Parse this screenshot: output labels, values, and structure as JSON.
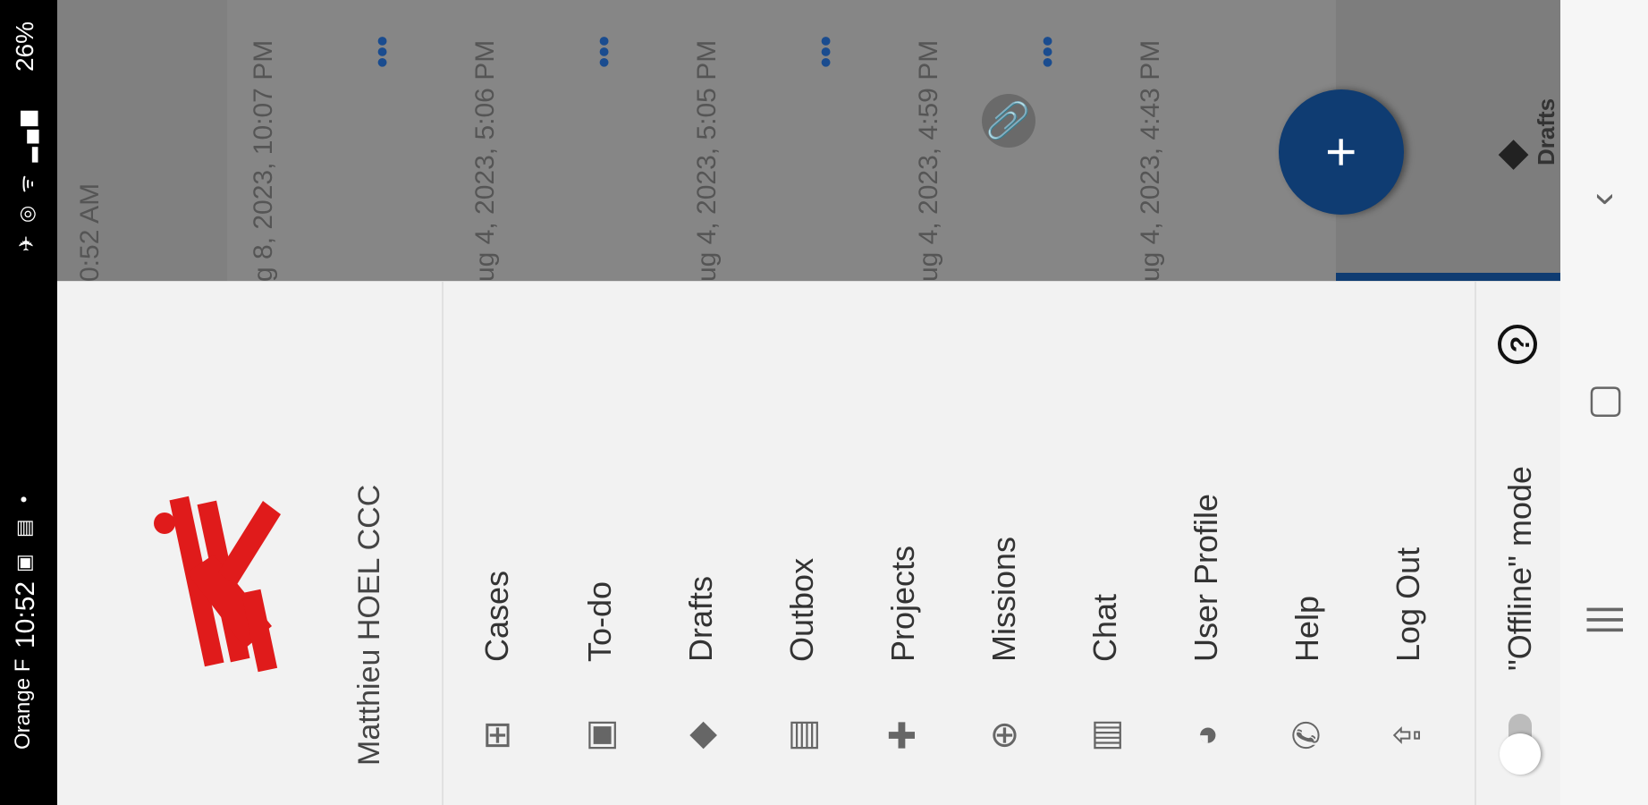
{
  "status_bar": {
    "carrier": "Orange F",
    "time": "10:52",
    "battery": "26%"
  },
  "drawer": {
    "user_name": "Matthieu HOEL CCC",
    "menu": [
      {
        "label": "Cases",
        "icon": "medical-case-icon"
      },
      {
        "label": "To-do",
        "icon": "todo-icon"
      },
      {
        "label": "Drafts",
        "icon": "drafts-icon"
      },
      {
        "label": "Outbox",
        "icon": "outbox-icon"
      },
      {
        "label": "Projects",
        "icon": "projects-icon"
      },
      {
        "label": "Missions",
        "icon": "globe-icon"
      },
      {
        "label": "Chat",
        "icon": "chat-icon"
      },
      {
        "label": "User Profile",
        "icon": "user-profile-icon"
      },
      {
        "label": "Help",
        "icon": "phone-icon"
      },
      {
        "label": "Log Out",
        "icon": "logout-icon"
      }
    ],
    "offline_mode_label": "\"Offline\" mode"
  },
  "background_list": {
    "title": "Drafts",
    "rows": [
      {
        "date": "0:52 AM"
      },
      {
        "date": "g 8, 2023, 10:07 PM"
      },
      {
        "date": "ug 4, 2023, 5:06 PM"
      },
      {
        "date": "ug 4, 2023, 5:05 PM"
      },
      {
        "date": "ug 4, 2023, 4:59 PM"
      },
      {
        "date": "ug 4, 2023, 4:43 PM"
      }
    ]
  },
  "colors": {
    "accent": "#0f3c72",
    "brand_red": "#e01b1b"
  }
}
